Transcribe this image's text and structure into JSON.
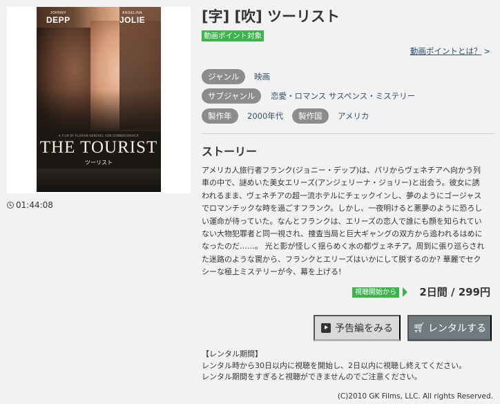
{
  "poster": {
    "actor_left_first": "JOHNNY",
    "actor_left_last": "DEPP",
    "actor_right_first": "ANGELINA",
    "actor_right_last": "JOLIE",
    "credit": "A FILM BY FLORIAN HENCKEL VON DONNERSMARCK",
    "title": "THE TOURIST",
    "subtitle": "ツーリスト"
  },
  "duration": "01:44:08",
  "title": "[字] [吹] ツーリスト",
  "point_badge": "動画ポイント対象",
  "point_link": "動画ポイントとは？",
  "point_link_arrow": ">",
  "tags": {
    "genre_label": "ジャンル",
    "genre_value": "映画",
    "subgenre_label": "サブジャンル",
    "subgenre_value": "恋愛・ロマンス サスペンス・ミステリー",
    "year_label": "製作年",
    "year_value": "2000年代",
    "country_label": "製作国",
    "country_value": "アメリカ"
  },
  "story": {
    "heading": "ストーリー",
    "lines": [
      "アメリカ人旅行者フランク(ジョニー・デップ)は、パリからヴェネチアへ向かう列",
      "車の中で、謎めいた美女エリーズ(アンジェリーナ・ジョリー)と出会う。彼女に誘",
      "われるまま、ヴェネチアの超一流ホテルにチェックインし、夢のようにゴージャス",
      "でロマンチックな時を過ごすフランク。しかし、一夜明けると悪夢のように恐ろし",
      "い運命が待っていた。なんとフランクは、エリーズの恋人で誰にも顔を知られてい",
      "ない大物犯罪者と同一視され、捜査当局と巨大ギャングの双方から追われるはめに",
      "なったのだ……。 光と影が怪しく揺らめく水の都ヴェネチア。周到に張り巡らされ",
      "た迷路のような罠から、フランクとエリーズはいかにして脱するのか? 華麗でセク",
      "シーな極上ミステリーが今、幕を上げる!"
    ]
  },
  "price_badge": "視聴開始から",
  "price": "2日間 / 299円",
  "buttons": {
    "trailer": "予告編をみる",
    "rental": "レンタルする"
  },
  "rental_info": {
    "heading": "【レンタル期間】",
    "line1": "レンタル時から30日以内に視聴を開始し、2日以内に視聴し終えてください。",
    "line2": "レンタル期間をすぎると視聴ができませんのでご注意ください。"
  },
  "copyright": "(C)2010 GK Films, LLC. All rights Reserved.",
  "colors": {
    "accent_green": "#3cb44b",
    "tag_gray": "#8c8c8c",
    "link_blue": "#2f4f6f",
    "rental_button": "#707b80"
  }
}
